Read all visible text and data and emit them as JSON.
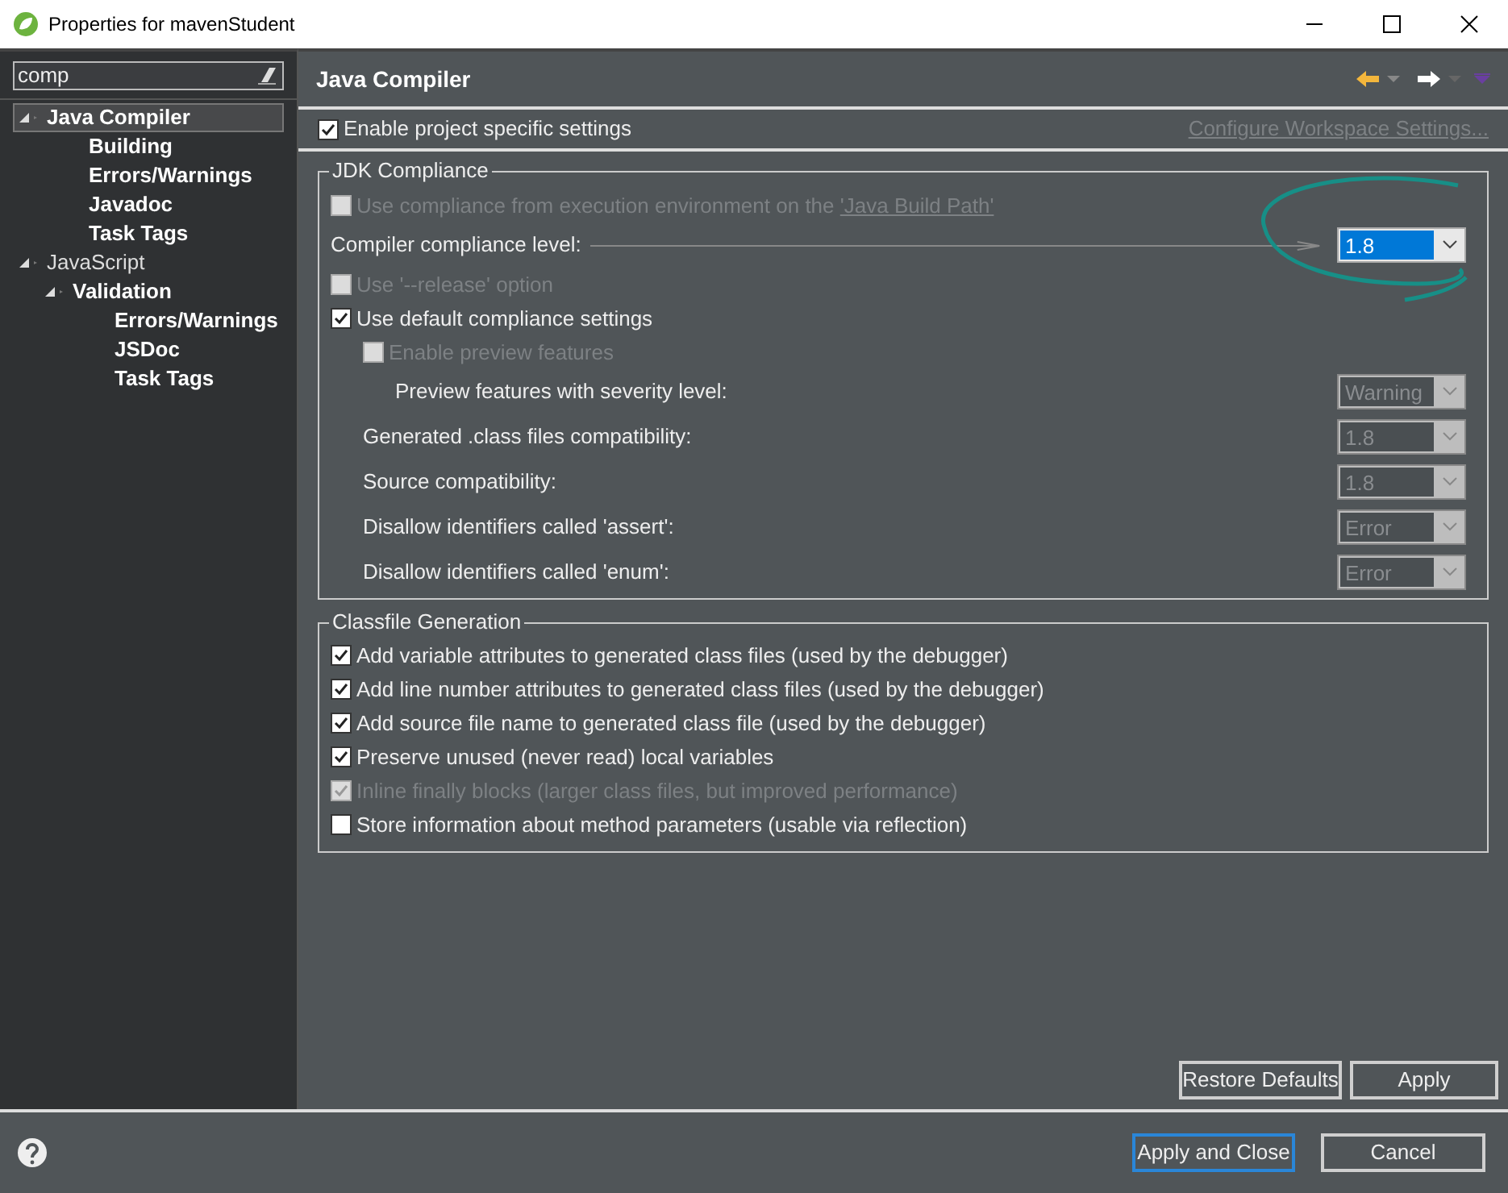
{
  "window": {
    "title": "Properties for mavenStudent"
  },
  "sidebar": {
    "search": {
      "value": "comp"
    },
    "tree": [
      {
        "label": "Java Compiler",
        "bold": true,
        "selected": true,
        "expanded": true,
        "children": [
          {
            "label": "Building",
            "bold": true,
            "selected": false
          },
          {
            "label": "Errors/Warnings",
            "bold": true,
            "selected": false
          },
          {
            "label": "Javadoc",
            "bold": true,
            "selected": false
          },
          {
            "label": "Task Tags",
            "bold": true,
            "selected": false
          }
        ]
      },
      {
        "label": "JavaScript",
        "bold": false,
        "selected": false,
        "expanded": true,
        "children": [
          {
            "label": "Validation",
            "bold": true,
            "selected": false,
            "expanded": true,
            "children": [
              {
                "label": "Errors/Warnings",
                "bold": true,
                "selected": false
              },
              {
                "label": "JSDoc",
                "bold": true,
                "selected": false
              },
              {
                "label": "Task Tags",
                "bold": true,
                "selected": false
              }
            ]
          }
        ]
      }
    ]
  },
  "page": {
    "title": "Java Compiler",
    "enable_project_settings": {
      "label": "Enable project specific settings",
      "checked": true
    },
    "configure_link": "Configure Workspace Settings...",
    "jdk_compliance": {
      "title": "JDK Compliance",
      "items": [
        {
          "kind": "checkbox",
          "label": "Use compliance from execution environment on the ",
          "link": "'Java Build Path'",
          "checked": false,
          "disabled": true
        },
        {
          "kind": "combo",
          "text": "Compiler compliance level:",
          "value": "1.8",
          "disabled": false,
          "leader": true
        },
        {
          "kind": "checkbox",
          "label": "Use '--release' option",
          "checked": false,
          "disabled": true
        },
        {
          "kind": "checkbox",
          "label": "Use default compliance settings",
          "checked": true,
          "disabled": false,
          "children": [
            {
              "kind": "checkbox",
              "label": "Enable preview features",
              "checked": false,
              "disabled": true,
              "children": [
                {
                  "kind": "combo",
                  "text": "Preview features with severity level:",
                  "value": "Warning",
                  "disabled": true
                }
              ]
            },
            {
              "kind": "combo",
              "text": "Generated .class files compatibility:",
              "value": "1.8",
              "disabled": true
            },
            {
              "kind": "combo",
              "text": "Source compatibility:",
              "value": "1.8",
              "disabled": true
            },
            {
              "kind": "combo",
              "text": "Disallow identifiers called 'assert':",
              "value": "Error",
              "disabled": true
            },
            {
              "kind": "combo",
              "text": "Disallow identifiers called 'enum':",
              "value": "Error",
              "disabled": true
            }
          ]
        }
      ]
    },
    "classfile_generation": {
      "title": "Classfile Generation",
      "items": [
        {
          "label": "Add variable attributes to generated class files (used by the debugger)",
          "checked": true,
          "disabled": false
        },
        {
          "label": "Add line number attributes to generated class files (used by the debugger)",
          "checked": true,
          "disabled": false
        },
        {
          "label": "Add source file name to generated class file (used by the debugger)",
          "checked": true,
          "disabled": false
        },
        {
          "label": "Preserve unused (never read) local variables",
          "checked": true,
          "disabled": false
        },
        {
          "label": "Inline finally blocks (larger class files, but improved performance)",
          "checked": true,
          "disabled": true
        },
        {
          "label": "Store information about method parameters (usable via reflection)",
          "checked": false,
          "disabled": false
        }
      ]
    },
    "buttons": [
      {
        "label": "Restore Defaults",
        "default": false
      },
      {
        "label": "Apply",
        "default": false
      }
    ]
  },
  "footer": {
    "buttons": [
      {
        "label": "Apply and Close",
        "default": true
      },
      {
        "label": "Cancel",
        "default": false
      }
    ]
  }
}
